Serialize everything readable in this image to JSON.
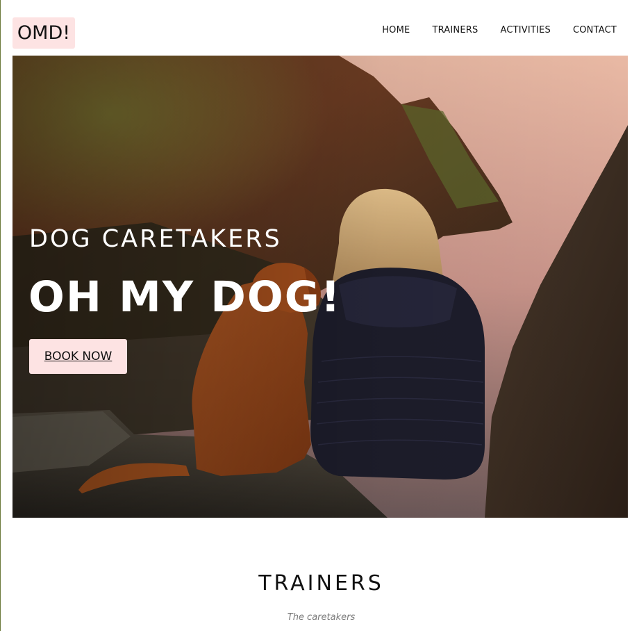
{
  "header": {
    "logo_text": "OMD!",
    "nav": {
      "home": "HOME",
      "trainers": "TRAINERS",
      "activities": "ACTIVITIES",
      "contact": "CONTACT"
    }
  },
  "hero": {
    "subtitle": "DOG CARETAKERS",
    "title": "OH MY DOG!",
    "cta_label": "BOOK NOW"
  },
  "trainers": {
    "heading": "TRAINERS",
    "subheading": "The caretakers"
  },
  "colors": {
    "accent_pink": "#fde3e3",
    "text_dark": "#111111",
    "muted_gray": "#7a7a7a"
  }
}
